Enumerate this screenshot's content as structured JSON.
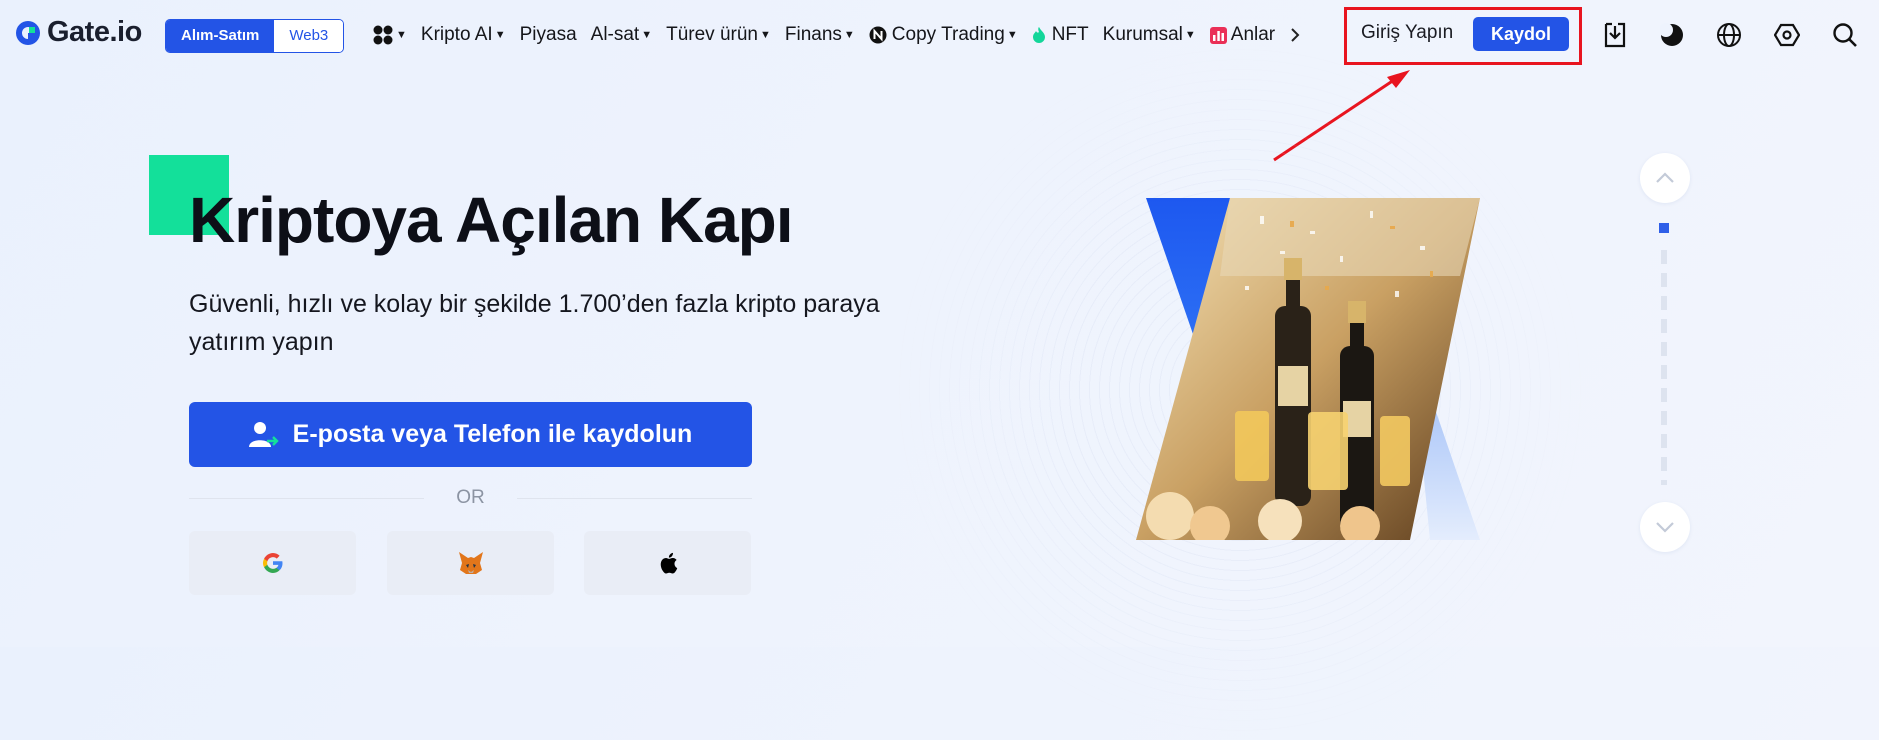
{
  "brand": {
    "name": "Gate.io",
    "mark_color": "#2354e6",
    "accent_green": "#13e09a"
  },
  "segment": {
    "active": "Alım-Satım",
    "inactive": "Web3"
  },
  "menu": [
    {
      "label": "Kripto AI",
      "has_caret": true,
      "icon": ""
    },
    {
      "label": "Piyasa",
      "has_caret": false,
      "icon": ""
    },
    {
      "label": "Al-sat",
      "has_caret": true,
      "icon": ""
    },
    {
      "label": "Türev ürün",
      "has_caret": true,
      "icon": ""
    },
    {
      "label": "Finans",
      "has_caret": true,
      "icon": ""
    },
    {
      "label": "Copy Trading",
      "has_caret": true,
      "icon": "N-badge-icon"
    },
    {
      "label": "NFT",
      "has_caret": false,
      "icon": "flame-icon"
    },
    {
      "label": "Kurumsal",
      "has_caret": true,
      "icon": ""
    },
    {
      "label": "Anlar",
      "has_caret": false,
      "icon": "chart-bars-icon"
    }
  ],
  "auth": {
    "login_label": "Giriş Yapın",
    "signup_label": "Kaydol",
    "highlight_color": "#e8141f"
  },
  "toolbar_icons": [
    "download-icon",
    "theme-moon-icon",
    "globe-icon",
    "settings-hex-icon",
    "search-icon"
  ],
  "hero": {
    "title": "Kriptoya Açılan Kapı",
    "subtitle": "Güvenli, hızlı ve kolay bir şekilde 1.700’den fazla kripto paraya yatırım yapın",
    "cta_label": "E-posta veya Telefon ile kaydolun",
    "or_label": "OR",
    "social": [
      "google-icon",
      "metamask-fox-icon",
      "apple-icon"
    ]
  },
  "carousel": {
    "up": "chevron-up-icon",
    "down": "chevron-down-icon"
  }
}
